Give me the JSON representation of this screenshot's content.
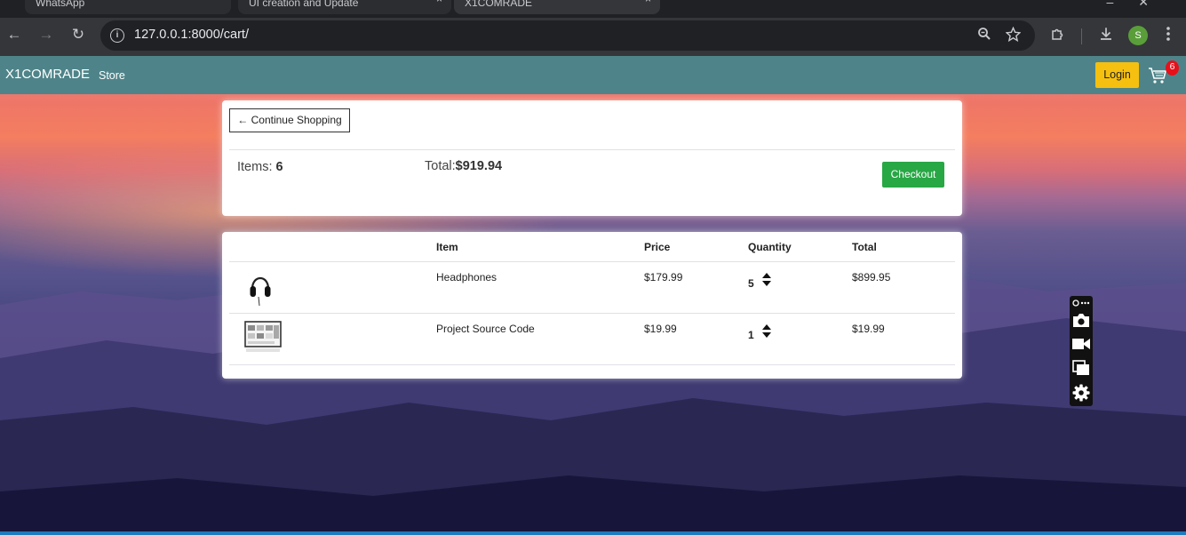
{
  "browser": {
    "tabs": [
      {
        "label": "WhatsApp"
      },
      {
        "label": "UI creation and Update"
      },
      {
        "label": "X1COMRADE"
      }
    ],
    "url": "127.0.0.1:8000/cart/",
    "profile_initial": "S"
  },
  "navbar": {
    "brand": "X1COMRADE",
    "store_link": "Store",
    "login_label": "Login",
    "cart_count": "6"
  },
  "summary": {
    "continue_label": "← Continue Shopping",
    "items_label": "Items: ",
    "items_count": "6",
    "total_label": "Total:",
    "total_value": "$919.94",
    "checkout_label": "Checkout"
  },
  "cart": {
    "headers": {
      "item": "Item",
      "price": "Price",
      "quantity": "Quantity",
      "total": "Total"
    },
    "rows": [
      {
        "name": "Headphones",
        "price": "$179.99",
        "quantity": "5",
        "total": "$899.95",
        "thumb_icon": "headphones-icon"
      },
      {
        "name": "Project Source Code",
        "price": "$19.99",
        "quantity": "1",
        "total": "$19.99",
        "thumb_icon": "monitor-screenshot-icon"
      }
    ]
  },
  "colors": {
    "navbar": "#4e8489",
    "login": "#f5c00f",
    "checkout": "#28a745",
    "badge": "#e8101a"
  }
}
